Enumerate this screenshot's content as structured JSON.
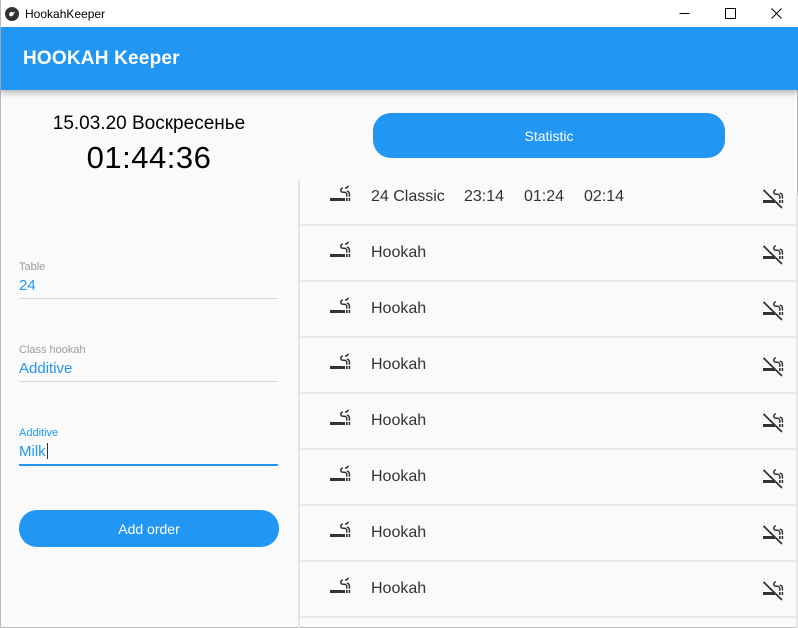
{
  "window": {
    "title": "HookahKeeper"
  },
  "appbar": {
    "title": "HOOKAH Keeper"
  },
  "header": {
    "date": "15.03.20 Воскресенье",
    "time": "01:44:36"
  },
  "form": {
    "table": {
      "label": "Table",
      "value": "24"
    },
    "class_hookah": {
      "label": "Class hookah",
      "value": "Additive"
    },
    "additive": {
      "label": "Additive",
      "value": "Milk"
    },
    "add_button": "Add order"
  },
  "statistic_button": "Statistic",
  "orders": [
    {
      "name": "24 Classic",
      "times": [
        "23:14",
        "01:24",
        "02:14"
      ]
    },
    {
      "name": "Hookah",
      "times": []
    },
    {
      "name": "Hookah",
      "times": []
    },
    {
      "name": "Hookah",
      "times": []
    },
    {
      "name": "Hookah",
      "times": []
    },
    {
      "name": "Hookah",
      "times": []
    },
    {
      "name": "Hookah",
      "times": []
    },
    {
      "name": "Hookah",
      "times": []
    }
  ],
  "colors": {
    "accent": "#2196f3",
    "icon": "#333333"
  },
  "icons": {
    "row_left": "smoking-icon",
    "row_right": "no-smoking-icon"
  }
}
